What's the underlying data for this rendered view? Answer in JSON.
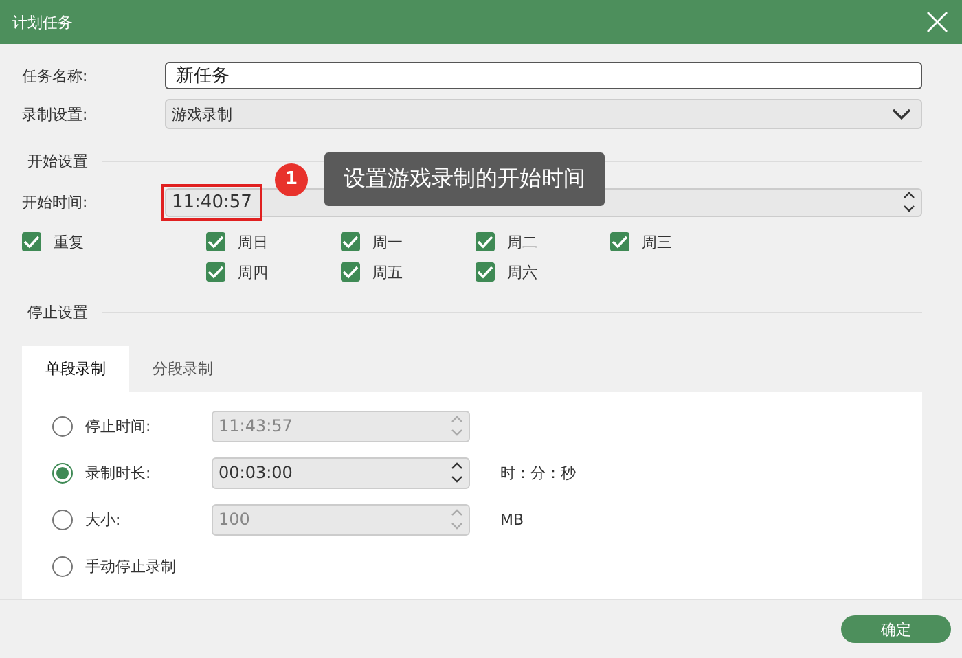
{
  "window": {
    "title": "计划任务"
  },
  "task_name": {
    "label": "任务名称:",
    "value": "新任务"
  },
  "recording_setting": {
    "label": "录制设置:",
    "value": "游戏录制"
  },
  "start_section": {
    "title": "开始设置"
  },
  "start_time": {
    "label": "开始时间:",
    "value": "11:40:57",
    "highlighted": true
  },
  "repeat": {
    "label": "重复",
    "checked": true
  },
  "days": [
    {
      "label": "周日",
      "checked": true
    },
    {
      "label": "周一",
      "checked": true
    },
    {
      "label": "周二",
      "checked": true
    },
    {
      "label": "周三",
      "checked": true
    },
    {
      "label": "周四",
      "checked": true
    },
    {
      "label": "周五",
      "checked": true
    },
    {
      "label": "周六",
      "checked": true
    }
  ],
  "stop_section": {
    "title": "停止设置"
  },
  "tabs": [
    {
      "label": "单段录制",
      "selected": true
    },
    {
      "label": "分段录制",
      "selected": false
    }
  ],
  "stop_options": [
    {
      "kind": "spinner",
      "label": "停止时间:",
      "selected": false,
      "value": "11:43:57",
      "disabled": true
    },
    {
      "kind": "spinner",
      "label": "录制时长:",
      "selected": true,
      "value": "00:03:00",
      "disabled": false,
      "unit": "时：分：秒"
    },
    {
      "kind": "spinner",
      "label": "大小:",
      "selected": false,
      "value": "100",
      "disabled": true,
      "unit": "MB"
    },
    {
      "kind": "plain",
      "label": "手动停止录制",
      "selected": false
    }
  ],
  "callout": {
    "number": "1",
    "text": "设置游戏录制的开始时间"
  },
  "confirm_button": "确定"
}
